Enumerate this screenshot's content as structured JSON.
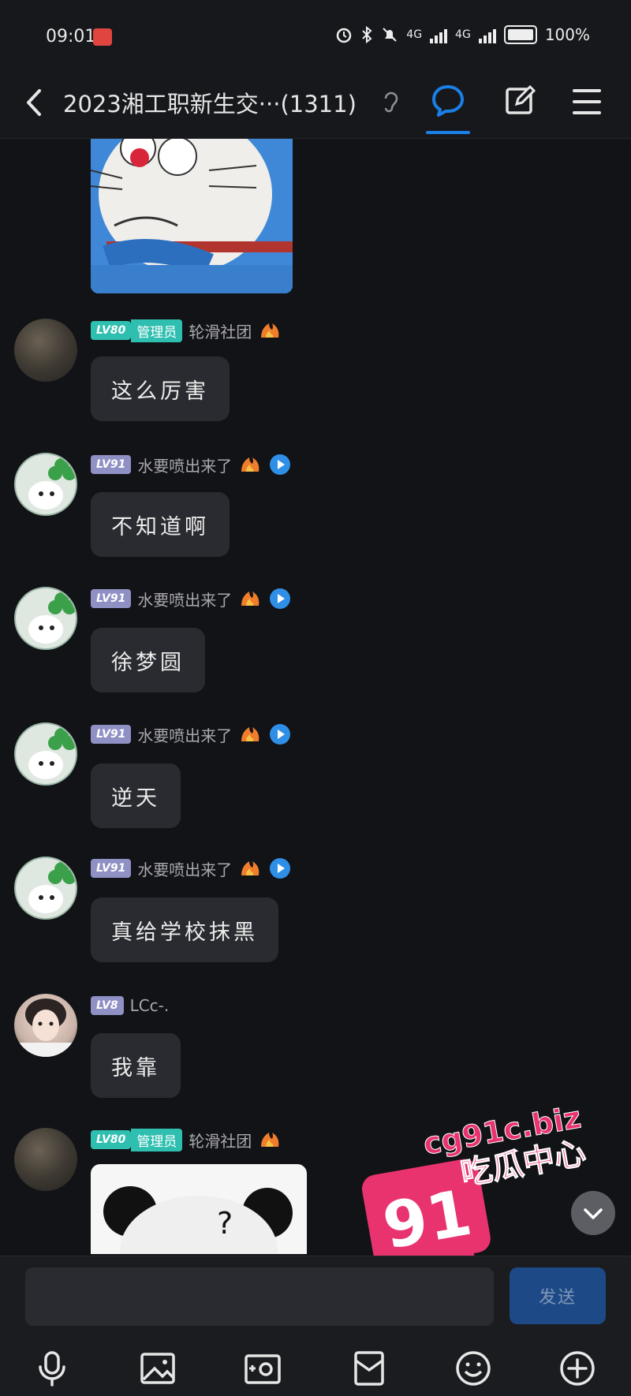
{
  "status_bar": {
    "time": "09:01",
    "network": "4G",
    "battery": "100%"
  },
  "header": {
    "title": "2023湘工职新生交···(1311)"
  },
  "messages": [
    {
      "level": "LV80",
      "role": "管理员",
      "name": "轮滑社团",
      "text": "这么厉害"
    },
    {
      "level": "LV91",
      "name": "水要喷出来了",
      "text": "不知道啊"
    },
    {
      "level": "LV91",
      "name": "水要喷出来了",
      "text": "徐梦圆"
    },
    {
      "level": "LV91",
      "name": "水要喷出来了",
      "text": "逆天"
    },
    {
      "level": "LV91",
      "name": "水要喷出来了",
      "text": "真给学校抹黑"
    },
    {
      "level": "LV8",
      "name": "LCc-.",
      "text": "我靠"
    },
    {
      "level": "LV80",
      "role": "管理员",
      "name": "轮滑社团"
    }
  ],
  "watermark": {
    "number": "91",
    "site": "cg91c.biz",
    "tagline": "吃瓜中心"
  },
  "input_bar": {
    "placeholder": "",
    "send_label": "发送"
  },
  "icons": [
    "back-icon",
    "ear-icon",
    "chat-icon",
    "edit-icon",
    "menu-icon",
    "fire-icon",
    "play-icon",
    "chevron-down-icon",
    "microphone-icon",
    "image-icon",
    "camera-icon",
    "red-packet-icon",
    "emoji-icon",
    "plus-icon"
  ],
  "colors": {
    "background": "#121317",
    "admin_badge": "#2fbfb0",
    "level_badge": "#8f90c4",
    "accent": "#1a7fe6",
    "bubble": "#2a2b30",
    "send_button": "#1d4a86"
  }
}
